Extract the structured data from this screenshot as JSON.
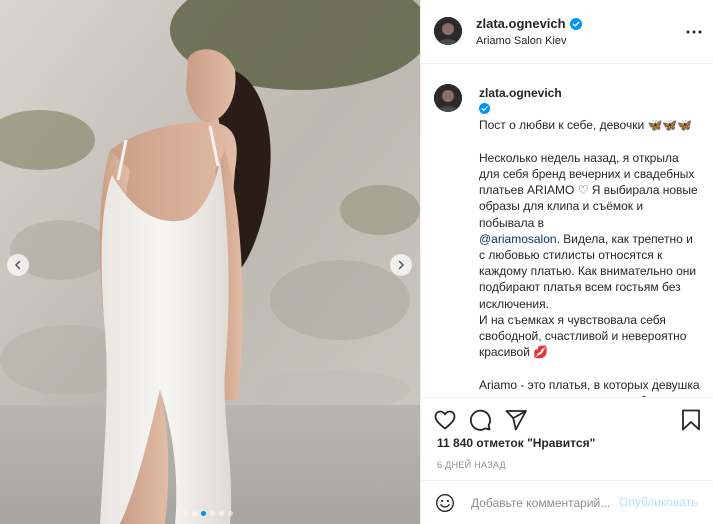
{
  "header": {
    "username": "zlata.ognevich",
    "location": "Ariamo Salon Kiev",
    "verified_icon": "verified-badge-icon",
    "more_icon": "more-options-icon"
  },
  "caption": {
    "username": "zlata.ognevich",
    "line1": "Пост о любви к себе, девочки 🦋🦋🦋",
    "paragraph1_a": "Несколько недель назад, я открыла для себя бренд вечерних и свадебных платьев ARIAMO ♡ Я выбирала новые образы для клипа и съёмок и побывала в",
    "mention": "@ariamosalon",
    "paragraph1_b": ". Видела, как трепетно и с любовью стилисты относятся к каждому платью. Как внимательно они подбирают платья всем гостьям без исключения.",
    "paragraph1_c": "И на съемках я чувствовала себя свободной, счастливой и невероятно красивой 💋",
    "paragraph2": "Ariamo - это платья, в которых девушка прежде всего почувствует себя СОБОЙ."
  },
  "actions": {
    "like_icon": "heart-icon",
    "comment_icon": "comment-icon",
    "share_icon": "share-icon",
    "save_icon": "bookmark-icon"
  },
  "likes_text": "11 840 отметок \"Нравится\"",
  "time_ago": "6 ДНЕЙ НАЗАД",
  "comment": {
    "placeholder": "Добавьте комментарий...",
    "post_label": "Опубликовать"
  },
  "carousel": {
    "total_slides": 6,
    "active_slide": 3
  },
  "colors": {
    "verified_blue": "#0095f6",
    "mention_blue": "#00376b",
    "post_disabled": "#b2dffc",
    "muted": "#8e8e8e"
  }
}
